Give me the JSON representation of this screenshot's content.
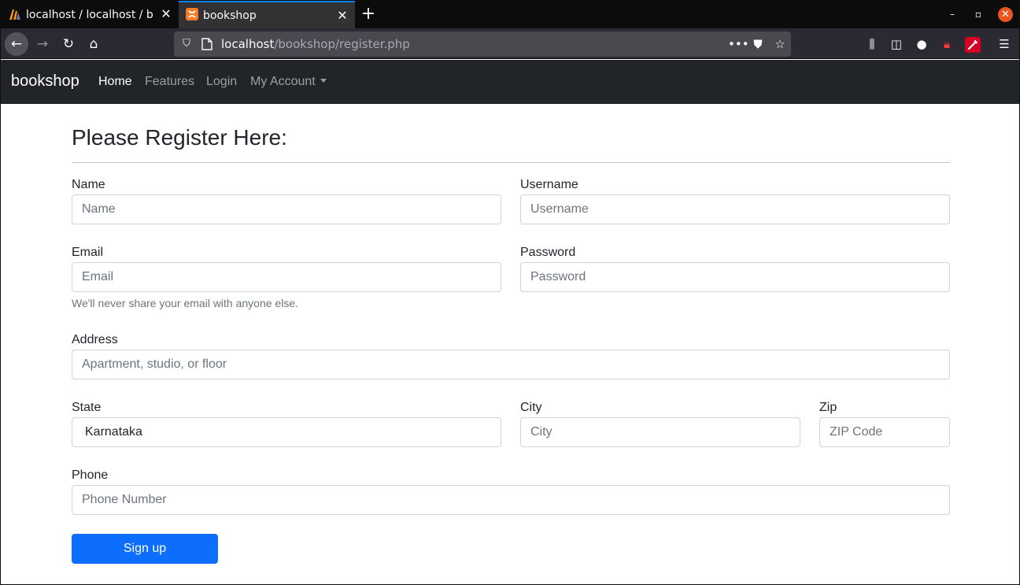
{
  "browser": {
    "tabs": [
      {
        "title": "localhost / localhost / bookshop | phpMyAdmin",
        "icon": "phpmyadmin-icon"
      },
      {
        "title": "bookshop",
        "icon": "xampp-icon",
        "active": true
      }
    ],
    "url": {
      "host": "localhost",
      "path": "/bookshop/register.php"
    }
  },
  "navbar": {
    "brand": "bookshop",
    "links": [
      "Home",
      "Features",
      "Login",
      "My Account"
    ]
  },
  "form": {
    "heading": "Please Register Here:",
    "name": {
      "label": "Name",
      "placeholder": "Name"
    },
    "username": {
      "label": "Username",
      "placeholder": "Username"
    },
    "email": {
      "label": "Email",
      "placeholder": "Email",
      "help": "We'll never share your email with anyone else."
    },
    "password": {
      "label": "Password",
      "placeholder": "Password"
    },
    "address": {
      "label": "Address",
      "placeholder": "Apartment, studio, or floor"
    },
    "state": {
      "label": "State",
      "value": "Karnataka"
    },
    "city": {
      "label": "City",
      "placeholder": "City"
    },
    "zip": {
      "label": "Zip",
      "placeholder": "ZIP Code"
    },
    "phone": {
      "label": "Phone",
      "placeholder": "Phone Number"
    },
    "submit_label": "Sign up"
  },
  "colors": {
    "navbar_bg": "#212529",
    "primary": "#0d6efd",
    "tab_accent": "#0a84ff",
    "window_close": "#e95420"
  }
}
